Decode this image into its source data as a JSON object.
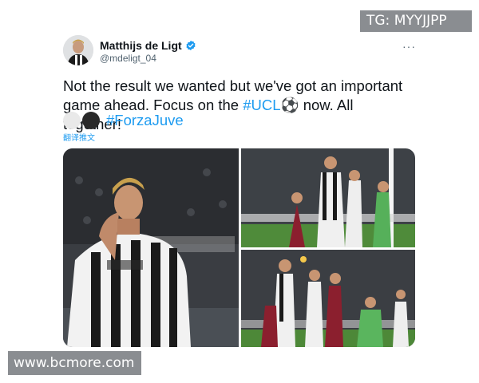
{
  "watermarks": {
    "top": "TG: MYYJJPP",
    "bottom": "www.bcmore.com"
  },
  "tweet": {
    "author": {
      "display_name": "Matthijs de Ligt",
      "handle": "@mdeligt_04",
      "verified": true,
      "avatar_icon": "avatar-photo"
    },
    "more_label": "···",
    "text_line1": "Not the result we wanted but we've got an important",
    "text_line2_prefix": "game ahead. Focus on the ",
    "hashtag_ucl": "#UCL",
    "ball_emoji": "⚽",
    "text_line2_suffix": " now. All together!",
    "hashtag_forzajuve": "#ForzaJuve",
    "translate_label": "翻译推文"
  },
  "colors": {
    "link": "#1d9bf0",
    "verified": "#1d9bf0",
    "text": "#0f1419",
    "secondary": "#536471",
    "watermark_bg": "#8a8d91"
  },
  "media": [
    {
      "name": "photo-celebration"
    },
    {
      "name": "photo-header-action"
    },
    {
      "name": "photo-goalmouth-scramble"
    }
  ]
}
